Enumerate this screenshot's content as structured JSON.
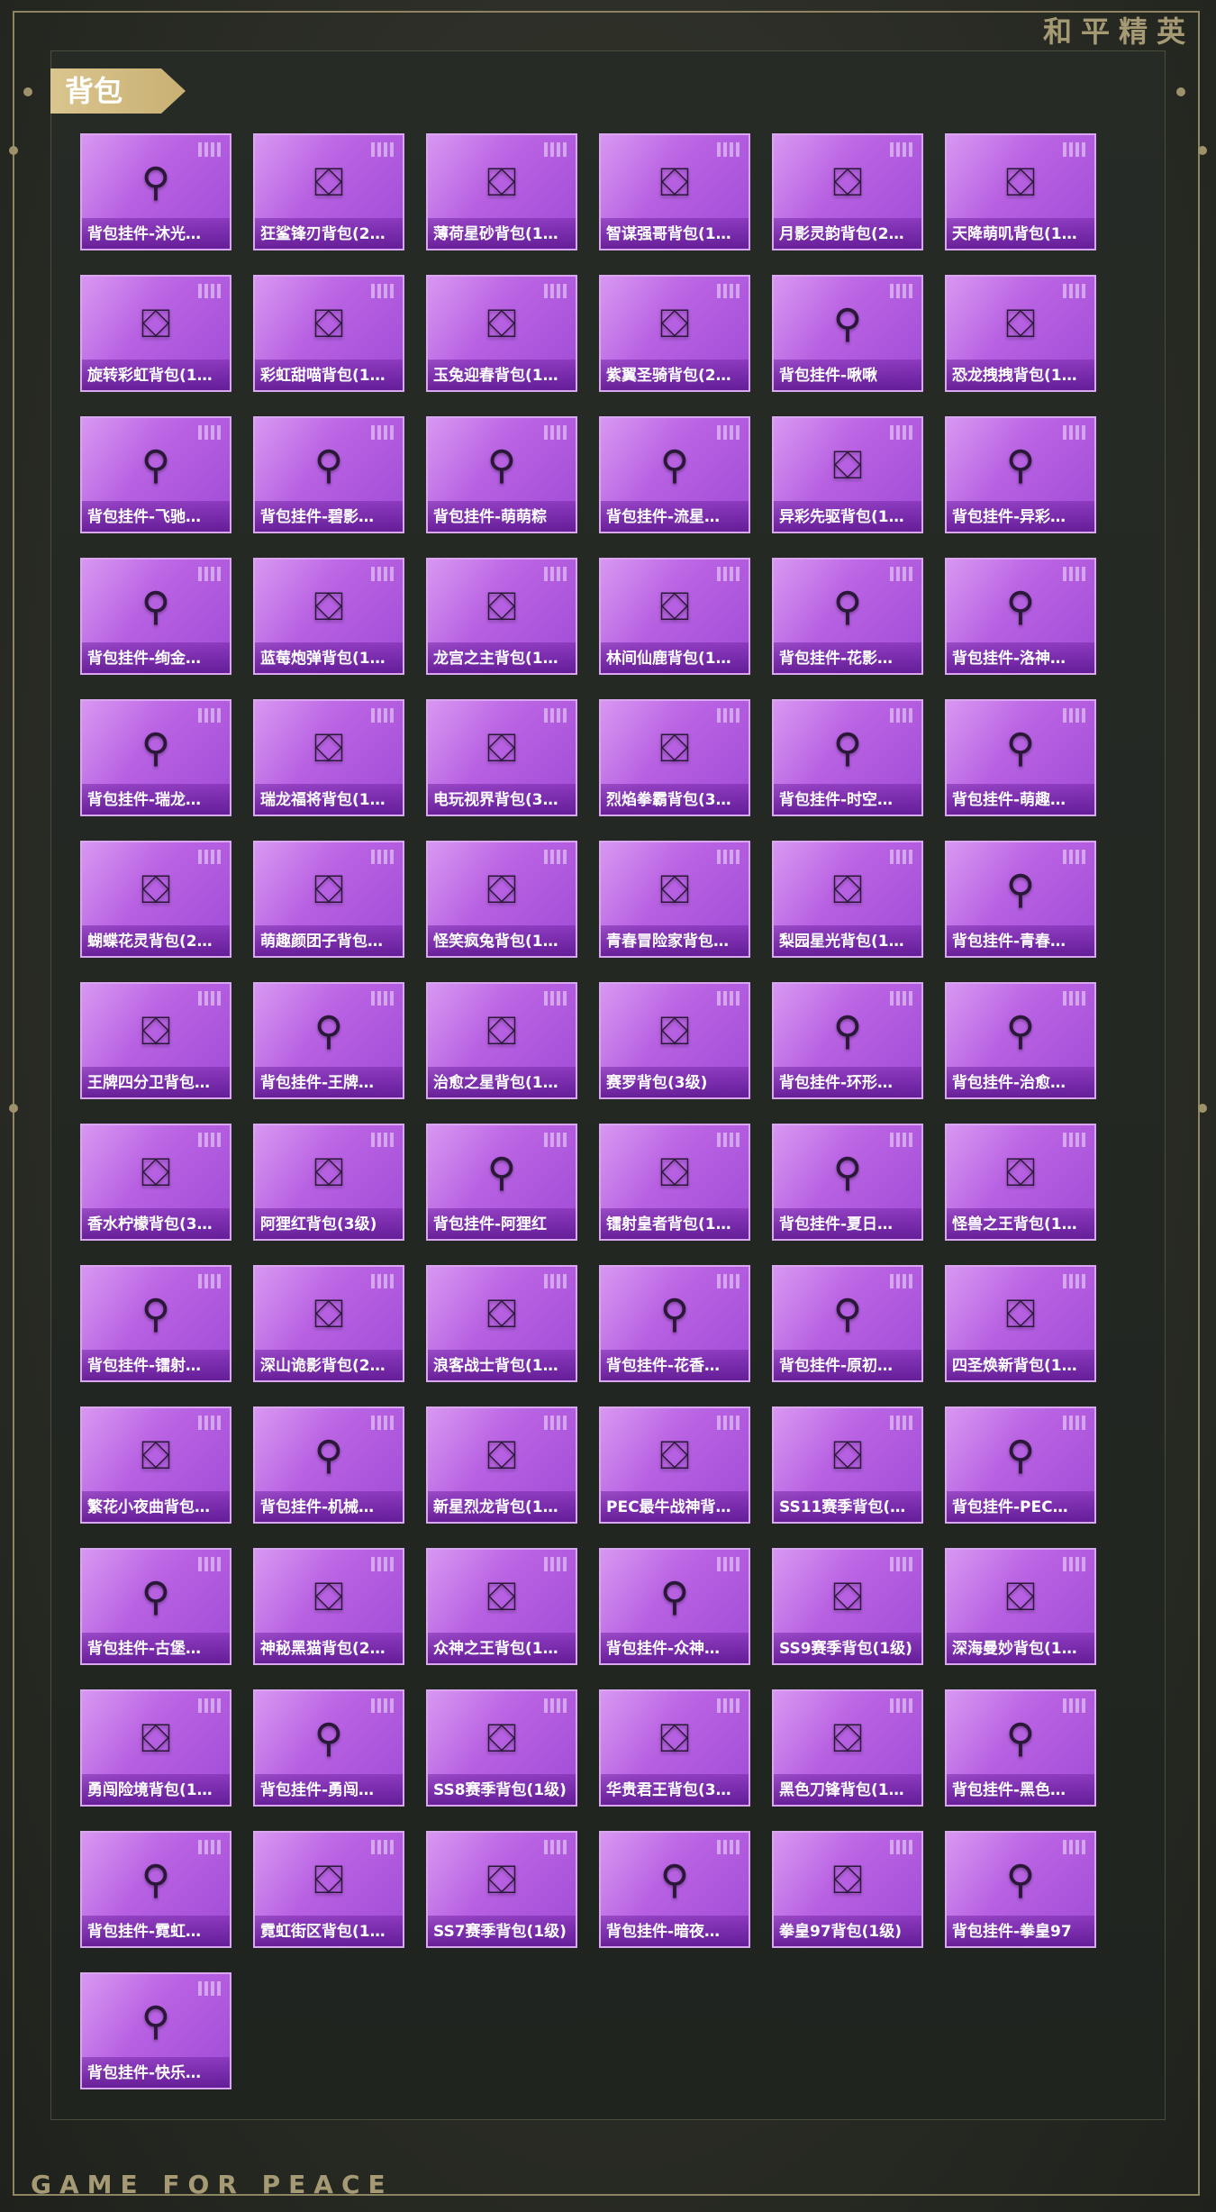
{
  "brand": {
    "cn": "和平精英",
    "en": "GAME FOR PEACE"
  },
  "section": {
    "title": "背包"
  },
  "items": [
    {
      "label": "背包挂件-沐光…",
      "icon": "cat-pendant-icon"
    },
    {
      "label": "狂鲨锋刃背包(2…",
      "icon": "shark-backpack-icon"
    },
    {
      "label": "薄荷星砂背包(1…",
      "icon": "mint-backpack-icon"
    },
    {
      "label": "智谋强哥背包(1…",
      "icon": "face-backpack-icon"
    },
    {
      "label": "月影灵韵背包(2…",
      "icon": "moon-backpack-icon"
    },
    {
      "label": "天降萌叽背包(1…",
      "icon": "orange-backpack-icon"
    },
    {
      "label": "旋转彩虹背包(1…",
      "icon": "rainbow-backpack-icon"
    },
    {
      "label": "彩虹甜喵背包(1…",
      "icon": "cat-backpack-icon"
    },
    {
      "label": "玉兔迎春背包(1…",
      "icon": "rabbit-backpack-icon"
    },
    {
      "label": "紫翼圣骑背包(2…",
      "icon": "knight-backpack-icon"
    },
    {
      "label": "背包挂件-啾啾",
      "icon": "bird-pendant-icon"
    },
    {
      "label": "恐龙拽拽背包(1…",
      "icon": "dino-backpack-icon"
    },
    {
      "label": "背包挂件-飞驰…",
      "icon": "eye-pendant-icon"
    },
    {
      "label": "背包挂件-碧影…",
      "icon": "tag-pendant-icon"
    },
    {
      "label": "背包挂件-萌萌粽",
      "icon": "zongzi-pendant-icon"
    },
    {
      "label": "背包挂件-流星…",
      "icon": "star-pendant-icon"
    },
    {
      "label": "异彩先驱背包(1…",
      "icon": "pink-backpack-icon"
    },
    {
      "label": "背包挂件-异彩…",
      "icon": "skate-pendant-icon"
    },
    {
      "label": "背包挂件-绚金…",
      "icon": "crown-pendant-icon"
    },
    {
      "label": "蓝莓炮弹背包(1…",
      "icon": "berry-backpack-icon"
    },
    {
      "label": "龙宫之主背包(1…",
      "icon": "dragon-palace-backpack-icon"
    },
    {
      "label": "林间仙鹿背包(1…",
      "icon": "deer-backpack-icon"
    },
    {
      "label": "背包挂件-花影…",
      "icon": "flower-pendant-icon"
    },
    {
      "label": "背包挂件-洛神…",
      "icon": "ribbon-pendant-icon"
    },
    {
      "label": "背包挂件-瑞龙…",
      "icon": "key-pendant-icon"
    },
    {
      "label": "瑞龙福将背包(1…",
      "icon": "dragon-backpack-icon"
    },
    {
      "label": "电玩视界背包(3…",
      "icon": "arcade-backpack-icon"
    },
    {
      "label": "烈焰拳霸背包(3…",
      "icon": "fire-backpack-icon"
    },
    {
      "label": "背包挂件-时空…",
      "icon": "wing-pendant-icon"
    },
    {
      "label": "背包挂件-萌趣…",
      "icon": "ufo-pendant-icon"
    },
    {
      "label": "蝴蝶花灵背包(2…",
      "icon": "butterfly-backpack-icon"
    },
    {
      "label": "萌趣颜团子背包…",
      "icon": "radish-backpack-icon"
    },
    {
      "label": "怪笑疯兔背包(1…",
      "icon": "bunny-backpack-icon"
    },
    {
      "label": "青春冒险家背包…",
      "icon": "adventure-backpack-icon"
    },
    {
      "label": "梨园星光背包(1…",
      "icon": "opera-backpack-icon"
    },
    {
      "label": "背包挂件-青春…",
      "icon": "monster-pendant-icon"
    },
    {
      "label": "王牌四分卫背包…",
      "icon": "shield-backpack-icon"
    },
    {
      "label": "背包挂件-王牌…",
      "icon": "ball-pendant-icon"
    },
    {
      "label": "治愈之星背包(1…",
      "icon": "star-backpack-icon"
    },
    {
      "label": "赛罗背包(3级)",
      "icon": "hero-backpack-icon"
    },
    {
      "label": "背包挂件-环形…",
      "icon": "ring-pendant-icon"
    },
    {
      "label": "背包挂件-治愈…",
      "icon": "can-pendant-icon"
    },
    {
      "label": "香水柠檬背包(3…",
      "icon": "duck-backpack-icon"
    },
    {
      "label": "阿狸红背包(3级)",
      "icon": "fox-backpack-icon"
    },
    {
      "label": "背包挂件-阿狸红",
      "icon": "fox-pendant-icon"
    },
    {
      "label": "镭射皇者背包(1…",
      "icon": "laser-backpack-icon"
    },
    {
      "label": "背包挂件-夏日…",
      "icon": "icecream-pendant-icon"
    },
    {
      "label": "怪兽之王背包(1…",
      "icon": "monster-king-backpack-icon"
    },
    {
      "label": "背包挂件-镭射…",
      "icon": "headphone-pendant-icon"
    },
    {
      "label": "深山诡影背包(2…",
      "icon": "mountain-backpack-icon"
    },
    {
      "label": "浪客战士背包(1…",
      "icon": "warrior-backpack-icon"
    },
    {
      "label": "背包挂件-花香…",
      "icon": "charm-pendant-icon"
    },
    {
      "label": "背包挂件-原初…",
      "icon": "badge-pendant-icon"
    },
    {
      "label": "四圣焕新背包(1…",
      "icon": "white-backpack-icon"
    },
    {
      "label": "繁花小夜曲背包…",
      "icon": "gear-backpack-icon"
    },
    {
      "label": "背包挂件-机械…",
      "icon": "mech-pendant-icon"
    },
    {
      "label": "新星烈龙背包(1…",
      "icon": "nova-backpack-icon"
    },
    {
      "label": "PEC最牛战神背…",
      "icon": "guitar-backpack-icon"
    },
    {
      "label": "SS11赛季背包(…",
      "icon": "ss11-backpack-icon"
    },
    {
      "label": "背包挂件-PEC…",
      "icon": "pec-pendant-icon"
    },
    {
      "label": "背包挂件-古堡…",
      "icon": "bat-pendant-icon"
    },
    {
      "label": "神秘黑猫背包(2…",
      "icon": "black-cat-backpack-icon"
    },
    {
      "label": "众神之王背包(1…",
      "icon": "gods-backpack-icon"
    },
    {
      "label": "背包挂件-众神…",
      "icon": "wings-pendant-icon"
    },
    {
      "label": "SS9赛季背包(1级)",
      "icon": "ss9-backpack-icon"
    },
    {
      "label": "深海曼妙背包(1…",
      "icon": "deep-sea-backpack-icon"
    },
    {
      "label": "勇闯险境背包(1…",
      "icon": "brave-backpack-icon"
    },
    {
      "label": "背包挂件-勇闯…",
      "icon": "chest-pendant-icon"
    },
    {
      "label": "SS8赛季背包(1级)",
      "icon": "ss8-backpack-icon"
    },
    {
      "label": "华贵君王背包(3…",
      "icon": "king-backpack-icon"
    },
    {
      "label": "黑色刀锋背包(1…",
      "icon": "blade-backpack-icon"
    },
    {
      "label": "背包挂件-黑色…",
      "icon": "logo-pendant-icon"
    },
    {
      "label": "背包挂件-霓虹…",
      "icon": "neon-pendant-icon"
    },
    {
      "label": "霓虹街区背包(1…",
      "icon": "neon-backpack-icon"
    },
    {
      "label": "SS7赛季背包(1级)",
      "icon": "ss7-backpack-icon"
    },
    {
      "label": "背包挂件-暗夜…",
      "icon": "night-pendant-icon"
    },
    {
      "label": "拳皇97背包(1级)",
      "icon": "kof-backpack-icon"
    },
    {
      "label": "背包挂件-拳皇97",
      "icon": "arcade-pendant-icon"
    },
    {
      "label": "背包挂件-快乐…",
      "icon": "happy-pendant-icon"
    }
  ]
}
